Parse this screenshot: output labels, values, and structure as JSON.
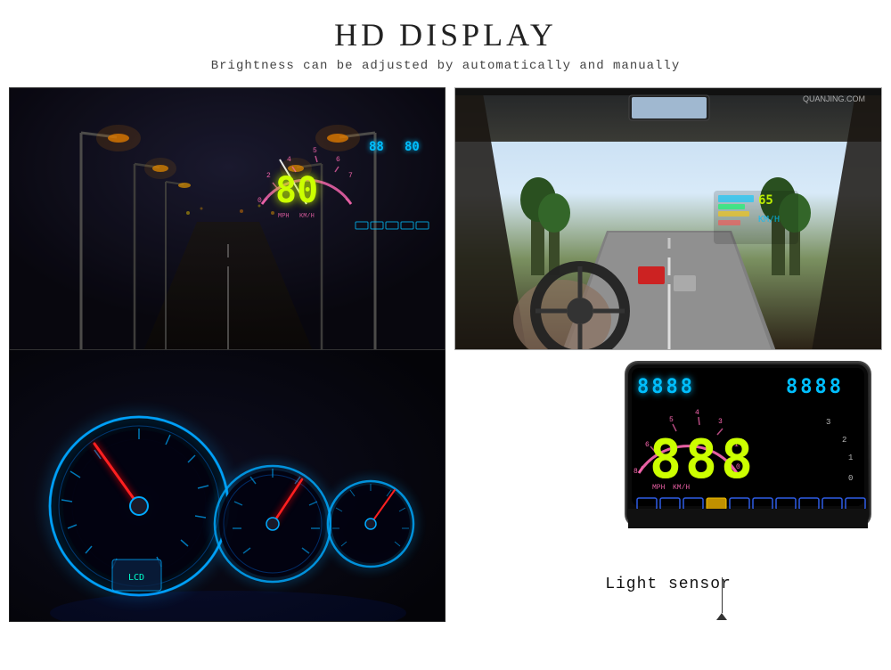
{
  "header": {
    "main_title": "HD DISPLAY",
    "subtitle": "Brightness can be adjusted by automatically and manually"
  },
  "night_hud": {
    "speed_large": "80",
    "speed_small_left": "88",
    "speed_small_right": "80"
  },
  "device": {
    "digits_left": "8888",
    "digits_right": "8888",
    "speed_display": "888"
  },
  "light_sensor_label": "Light sensor",
  "watermark": "QUANJING.COM"
}
